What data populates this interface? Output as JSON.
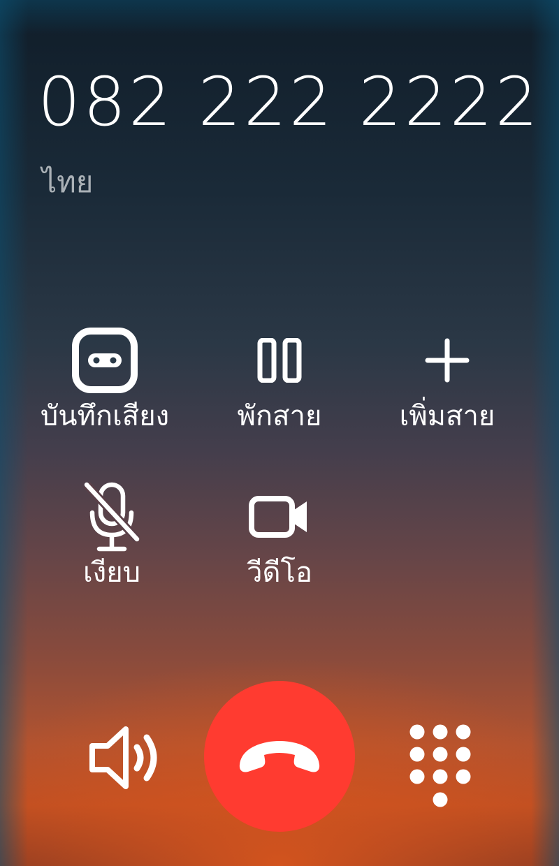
{
  "call": {
    "number": "082 222 2222",
    "location": "ไทย"
  },
  "actions": [
    {
      "id": "record",
      "label": "บันทึกเสียง",
      "icon": "voicemail-icon"
    },
    {
      "id": "hold",
      "label": "พักสาย",
      "icon": "pause-icon"
    },
    {
      "id": "add_call",
      "label": "เพิ่มสาย",
      "icon": "plus-icon"
    },
    {
      "id": "mute",
      "label": "เงียบ",
      "icon": "mic-off-icon"
    },
    {
      "id": "video",
      "label": "วีดีโอ",
      "icon": "video-camera-icon"
    }
  ],
  "controls": {
    "speaker_icon": "speaker-icon",
    "end_call_icon": "phone-hangup-icon",
    "end_call_color": "#ff3b30",
    "keypad_icon": "dialpad-icon"
  }
}
